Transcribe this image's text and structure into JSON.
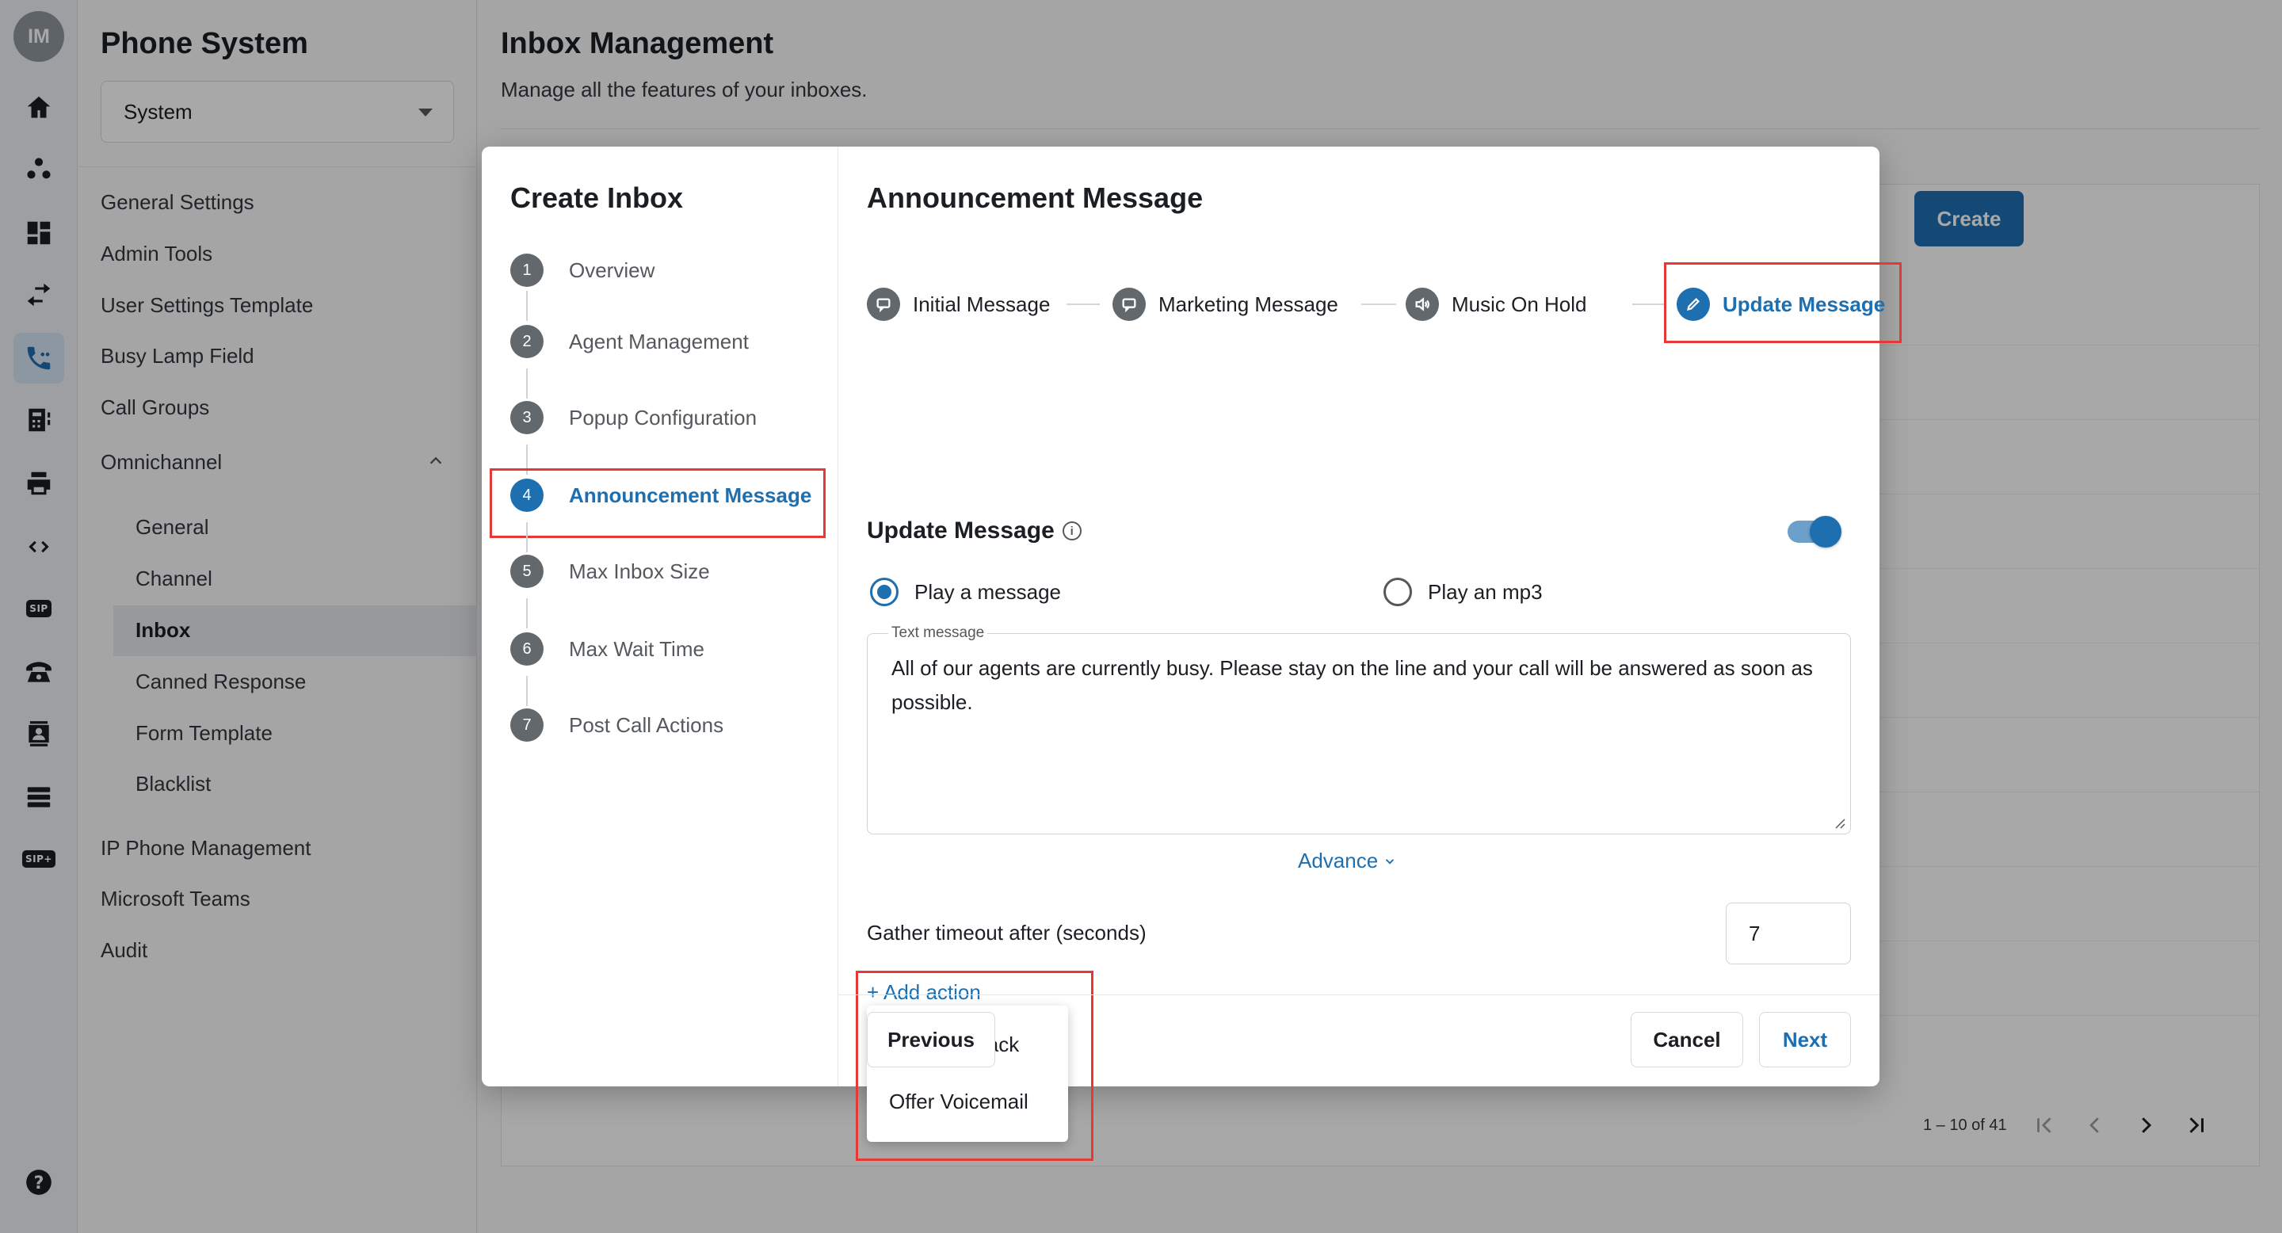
{
  "rail": {
    "avatar_initials": "IM",
    "icons": [
      "home-icon",
      "users-icon",
      "dashboard-icon",
      "transfer-icon",
      "phone-settings-icon",
      "directory-icon",
      "printer-icon",
      "code-icon",
      "sip-icon",
      "desk-phone-icon",
      "contact-icon",
      "storage-icon",
      "sip-plus-icon",
      "help-icon"
    ],
    "sip_label": "SIP",
    "sip_plus_label": "SIP+",
    "help_label": "?"
  },
  "sidebar": {
    "title": "Phone System",
    "select_value": "System",
    "items": [
      "General Settings",
      "Admin Tools",
      "User Settings Template",
      "Busy Lamp Field",
      "Call Groups",
      "Omnichannel"
    ],
    "omnichannel_children": [
      "General",
      "Channel",
      "Inbox",
      "Canned Response",
      "Form Template",
      "Blacklist"
    ],
    "bottom_items": [
      "IP Phone Management",
      "Microsoft Teams",
      "Audit"
    ]
  },
  "page": {
    "title": "Inbox Management",
    "subtitle": "Manage all the features of your inboxes.",
    "create_label": "Create",
    "pagination": "1 – 10 of 41"
  },
  "modal": {
    "title": "Create Inbox",
    "steps": [
      {
        "num": "1",
        "label": "Overview"
      },
      {
        "num": "2",
        "label": "Agent Management"
      },
      {
        "num": "3",
        "label": "Popup Configuration"
      },
      {
        "num": "4",
        "label": "Announcement Message"
      },
      {
        "num": "5",
        "label": "Max Inbox Size"
      },
      {
        "num": "6",
        "label": "Max Wait Time"
      },
      {
        "num": "7",
        "label": "Post Call Actions"
      }
    ],
    "section_title": "Announcement Message",
    "sub_steps": [
      "Initial Message",
      "Marketing Message",
      "Music On Hold",
      "Update Message"
    ],
    "update_message_title": "Update Message",
    "info_icon": "i",
    "radio_play_message": "Play a message",
    "radio_play_mp3": "Play an mp3",
    "text_message_label": "Text message",
    "text_message_value": "All of our agents are currently busy. Please stay on the line and your call will be answered as soon as possible.",
    "advance_label": "Advance",
    "gather_timeout_label": "Gather timeout after (seconds)",
    "gather_timeout_value": "7",
    "add_action_label": "+ Add action",
    "dropdown_items": [
      "Offer Callback",
      "Offer Voicemail"
    ],
    "previous_label": "Previous",
    "cancel_label": "Cancel",
    "next_label": "Next"
  },
  "colors": {
    "accent": "#1d6fb0",
    "highlight": "#e53935"
  }
}
